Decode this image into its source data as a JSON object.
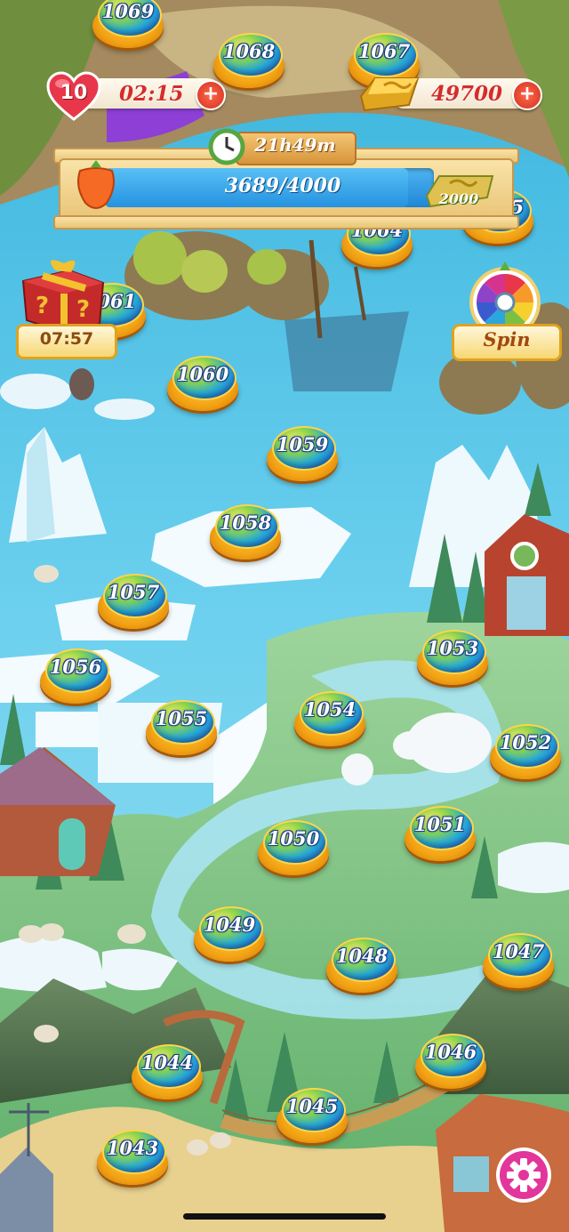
{
  "hud": {
    "lives": "10",
    "life_timer": "02:15",
    "coins": "49700",
    "plus_symbol": "+"
  },
  "event": {
    "timer": "21h49m",
    "progress_text": "3689/4000",
    "progress_fraction": 0.922,
    "reward_amount": "2000"
  },
  "side": {
    "gift_timer": "07:57",
    "spin_label": "Spin"
  },
  "levels": [
    "1069",
    "1068",
    "1067",
    "1065",
    "1064",
    "1061",
    "1060",
    "1059",
    "1058",
    "1057",
    "1056",
    "1055",
    "1054",
    "1053",
    "1052",
    "1051",
    "1050",
    "1049",
    "1048",
    "1047",
    "1046",
    "1045",
    "1044",
    "1043"
  ],
  "colors": {
    "accent_red": "#d52c2c",
    "water": "#5fc3e4",
    "gold": "#f2a214",
    "settings_pink": "#e2369b"
  },
  "icons": [
    "heart-icon",
    "plus-icon",
    "gold-bar-icon",
    "clock-icon",
    "carrot-icon",
    "gift-box-icon",
    "prize-wheel-icon",
    "settings-gear-icon"
  ]
}
